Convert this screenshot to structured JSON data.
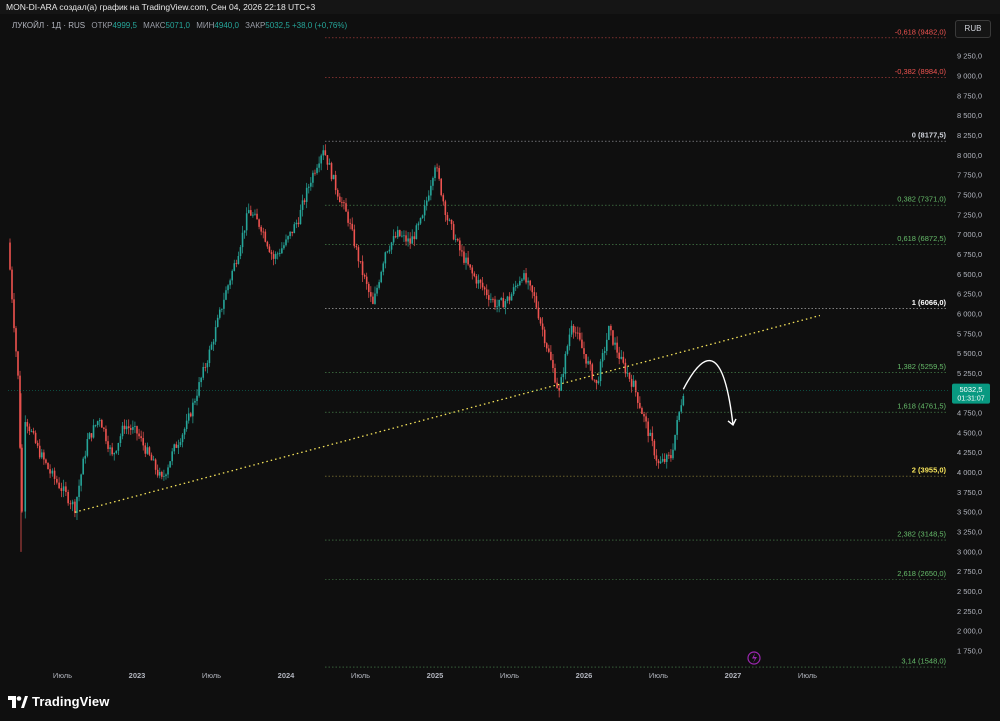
{
  "header": {
    "title": "MON-DI-ARA создал(а) график на TradingView.com, Сен 04, 2026 22:18 UTC+3"
  },
  "symbol": {
    "name": "ЛУКОЙЛ · 1Д · RUS",
    "open_label": "ОТКР",
    "open_value": "4999,5",
    "high_label": "МАКС",
    "high_value": "5071,0",
    "low_label": "МИН",
    "low_value": "4940,0",
    "close_label": "ЗАКР",
    "close_value": "5032,5",
    "change": "+38,0 (+0,76%)"
  },
  "currency": "RUB",
  "price_tag": {
    "price": "5032,5",
    "timer": "01:31:07",
    "color": "#089981"
  },
  "logo": {
    "text": "TradingView"
  },
  "colors": {
    "background": "#0f0f0f",
    "up": "#26a69a",
    "down": "#ef5350",
    "fib_red": "#ef5350",
    "fib_green": "#66bb6a",
    "fib_yellow": "#f5e35a",
    "trendline": "#f5e35a",
    "icon_purple": "#9c27b0"
  },
  "chart_data": {
    "type": "candlestick",
    "symbol": "ЛУКОЙЛ",
    "timeframe": "1Д",
    "y_axis": {
      "min": 1750,
      "max": 9250,
      "step": 250,
      "tick_labels": [
        "9 250,0",
        "9 000,0",
        "8 750,0",
        "8 500,0",
        "8 250,0",
        "8 000,0",
        "7 750,0",
        "7 500,0",
        "7 250,0",
        "7 000,0",
        "6 750,0",
        "6 500,0",
        "6 250,0",
        "6 000,0",
        "5 750,0",
        "5 500,0",
        "5 250,0",
        "5 000,0",
        "4 750,0",
        "4 500,0",
        "4 250,0",
        "4 000,0",
        "3 750,0",
        "3 500,0",
        "3 250,0",
        "3 000,0",
        "2 750,0",
        "2 500,0",
        "2 250,0",
        "2 000,0",
        "1 750,0"
      ]
    },
    "x_axis": {
      "tick_labels": [
        {
          "label": "Июль",
          "date": "2022-07"
        },
        {
          "label": "2023",
          "date": "2023-01"
        },
        {
          "label": "Июль",
          "date": "2023-07"
        },
        {
          "label": "2024",
          "date": "2024-01"
        },
        {
          "label": "Июль",
          "date": "2024-07"
        },
        {
          "label": "2025",
          "date": "2025-01"
        },
        {
          "label": "Июль",
          "date": "2025-07"
        },
        {
          "label": "2026",
          "date": "2026-01"
        },
        {
          "label": "Июль",
          "date": "2026-07"
        },
        {
          "label": "2027",
          "date": "2027-01"
        },
        {
          "label": "Июль",
          "date": "2027-07"
        }
      ]
    },
    "fib_levels": [
      {
        "level": "-0,618",
        "price": 9482.0,
        "label": "-0,618 (9482,0)",
        "color": "#ef5350"
      },
      {
        "level": "-0,382",
        "price": 8984.0,
        "label": "-0,382 (8984,0)",
        "color": "#ef5350"
      },
      {
        "level": "0",
        "price": 8177.5,
        "label": "0 (8177,5)",
        "color": "#d1d4dc"
      },
      {
        "level": "0,382",
        "price": 7371.0,
        "label": "0,382 (7371,0)",
        "color": "#66bb6a"
      },
      {
        "level": "0,618",
        "price": 6872.5,
        "label": "0,618 (6872,5)",
        "color": "#66bb6a"
      },
      {
        "level": "1",
        "price": 6066.0,
        "label": "1 (6066,0)",
        "color": "#ffffff"
      },
      {
        "level": "1,382",
        "price": 5259.5,
        "label": "1,382 (5259,5)",
        "color": "#66bb6a"
      },
      {
        "level": "1,618",
        "price": 4761.5,
        "label": "1,618 (4761,5)",
        "color": "#66bb6a"
      },
      {
        "level": "2",
        "price": 3955.0,
        "label": "2 (3955,0)",
        "color": "#f5e35a"
      },
      {
        "level": "2,382",
        "price": 3148.5,
        "label": "2,382 (3148,5)",
        "color": "#66bb6a"
      },
      {
        "level": "2,618",
        "price": 2650.0,
        "label": "2,618 (2650,0)",
        "color": "#66bb6a"
      },
      {
        "level": "3,14",
        "price": 1548.0,
        "label": "3,14 (1548,0)",
        "color": "#66bb6a"
      }
    ],
    "trendline": {
      "start": {
        "date": "2022-08",
        "price": 3500
      },
      "end": {
        "date": "2027-08",
        "price": 5980
      },
      "style": "dotted"
    },
    "projection_arrow": {
      "start": {
        "date": "2026-09",
        "price": 5050
      },
      "peak": {
        "date": "2026-12",
        "price": 5450
      },
      "end": {
        "date": "2027-01",
        "price": 4600
      }
    },
    "price_path": [
      {
        "date": "2022-02",
        "price": 6900
      },
      {
        "date": "2022-03",
        "price": 5200
      },
      {
        "date": "2022-03",
        "price": 3500
      },
      {
        "date": "2022-04",
        "price": 4700
      },
      {
        "date": "2022-05",
        "price": 4300
      },
      {
        "date": "2022-06",
        "price": 4000
      },
      {
        "date": "2022-08",
        "price": 3560
      },
      {
        "date": "2022-09",
        "price": 4400
      },
      {
        "date": "2022-10",
        "price": 4700
      },
      {
        "date": "2022-11",
        "price": 4200
      },
      {
        "date": "2022-12",
        "price": 4600
      },
      {
        "date": "2023-01",
        "price": 4500
      },
      {
        "date": "2023-02",
        "price": 4200
      },
      {
        "date": "2023-03",
        "price": 3900
      },
      {
        "date": "2023-04",
        "price": 4300
      },
      {
        "date": "2023-05",
        "price": 4600
      },
      {
        "date": "2023-06",
        "price": 5100
      },
      {
        "date": "2023-07",
        "price": 5600
      },
      {
        "date": "2023-08",
        "price": 6200
      },
      {
        "date": "2023-09",
        "price": 6700
      },
      {
        "date": "2023-10",
        "price": 7300
      },
      {
        "date": "2023-11",
        "price": 7100
      },
      {
        "date": "2023-12",
        "price": 6700
      },
      {
        "date": "2024-01",
        "price": 6900
      },
      {
        "date": "2024-02",
        "price": 7200
      },
      {
        "date": "2024-03",
        "price": 7700
      },
      {
        "date": "2024-04",
        "price": 8100
      },
      {
        "date": "2024-05",
        "price": 7600
      },
      {
        "date": "2024-06",
        "price": 7200
      },
      {
        "date": "2024-07",
        "price": 6600
      },
      {
        "date": "2024-08",
        "price": 6100
      },
      {
        "date": "2024-09",
        "price": 6800
      },
      {
        "date": "2024-10",
        "price": 7000
      },
      {
        "date": "2024-11",
        "price": 6900
      },
      {
        "date": "2024-12",
        "price": 7200
      },
      {
        "date": "2025-01",
        "price": 7900
      },
      {
        "date": "2025-02",
        "price": 7200
      },
      {
        "date": "2025-03",
        "price": 6800
      },
      {
        "date": "2025-04",
        "price": 6500
      },
      {
        "date": "2025-05",
        "price": 6300
      },
      {
        "date": "2025-06",
        "price": 6100
      },
      {
        "date": "2025-07",
        "price": 6200
      },
      {
        "date": "2025-08",
        "price": 6500
      },
      {
        "date": "2025-09",
        "price": 6200
      },
      {
        "date": "2025-10",
        "price": 5600
      },
      {
        "date": "2025-11",
        "price": 5000
      },
      {
        "date": "2025-12",
        "price": 5900
      },
      {
        "date": "2026-01",
        "price": 5500
      },
      {
        "date": "2026-02",
        "price": 5100
      },
      {
        "date": "2026-03",
        "price": 5800
      },
      {
        "date": "2026-04",
        "price": 5400
      },
      {
        "date": "2026-05",
        "price": 5100
      },
      {
        "date": "2026-06",
        "price": 4600
      },
      {
        "date": "2026-07",
        "price": 4100
      },
      {
        "date": "2026-08",
        "price": 4200
      },
      {
        "date": "2026-09",
        "price": 5032.5
      }
    ]
  }
}
